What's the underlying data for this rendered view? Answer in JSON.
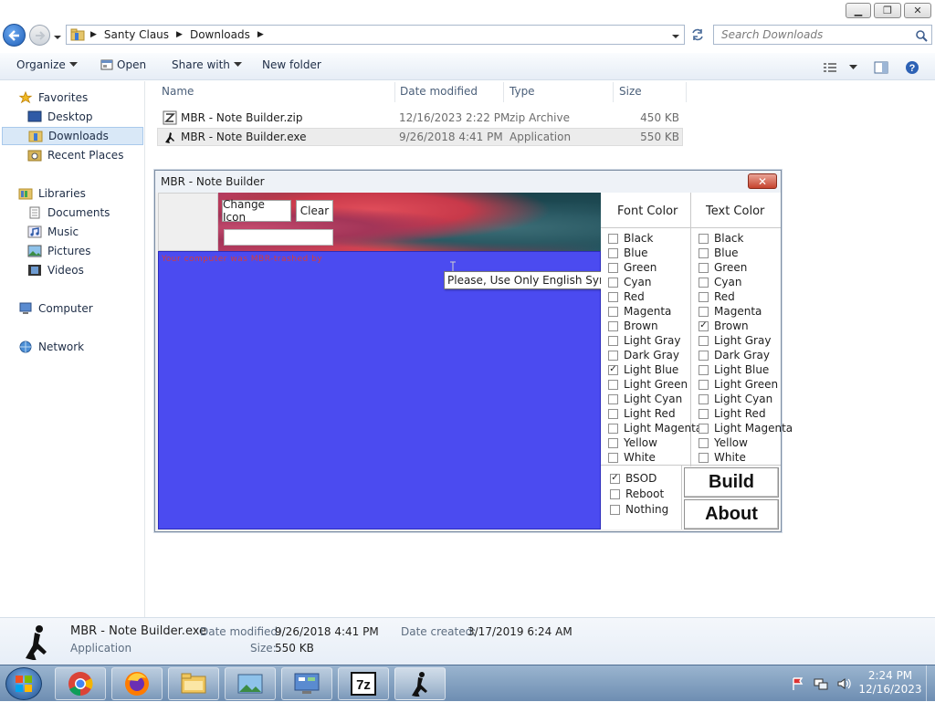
{
  "window": {
    "minimize_label": "▁",
    "restore_label": "❐",
    "close_label": "✕"
  },
  "address": {
    "breadcrumb": [
      "Santy Claus",
      "Downloads"
    ],
    "search_placeholder": "Search Downloads"
  },
  "toolbar": {
    "organize": "Organize",
    "open": "Open",
    "share_with": "Share with",
    "new_folder": "New folder"
  },
  "nav": {
    "favorites": "Favorites",
    "desktop": "Desktop",
    "downloads": "Downloads",
    "recent_places": "Recent Places",
    "libraries": "Libraries",
    "documents": "Documents",
    "music": "Music",
    "pictures": "Pictures",
    "videos": "Videos",
    "computer": "Computer",
    "network": "Network"
  },
  "columns": {
    "name": "Name",
    "date_modified": "Date modified",
    "type": "Type",
    "size": "Size"
  },
  "files": [
    {
      "name": "MBR - Note Builder.zip",
      "date": "12/16/2023 2:22 PM",
      "type": "zip Archive",
      "size": "450 KB"
    },
    {
      "name": "MBR - Note Builder.exe",
      "date": "9/26/2018 4:41 PM",
      "type": "Application",
      "size": "550 KB"
    }
  ],
  "details": {
    "name": "MBR - Note Builder.exe",
    "kind": "Application",
    "date_modified_label": "Date modified:",
    "date_modified": "9/26/2018 4:41 PM",
    "date_created_label": "Date created:",
    "date_created": "3/17/2019 6:24 AM",
    "size_label": "Size:",
    "size": "550 KB"
  },
  "dialog": {
    "title": "MBR - Note Builder",
    "close_label": "✕",
    "change_icon": "Change Icon",
    "clear": "Clear",
    "note_text": "Your computer was MBR-trashed by ",
    "tooltip": "Please, Use Only English Symbols",
    "font_color_header": "Font Color",
    "text_color_header": "Text Color",
    "colors": [
      "Black",
      "Blue",
      "Green",
      "Cyan",
      "Red",
      "Magenta",
      "Brown",
      "Light Gray",
      "Dark Gray",
      "Light Blue",
      "Light Green",
      "Light Cyan",
      "Light Red",
      "Light Magenta",
      "Yellow",
      "White"
    ],
    "font_color_checked": "Light Blue",
    "text_color_checked": "Brown",
    "options": [
      {
        "label": "BSOD",
        "checked": true
      },
      {
        "label": "Reboot",
        "checked": false
      },
      {
        "label": "Nothing",
        "checked": false
      }
    ],
    "build": "Build",
    "about": "About",
    "note_bg_color": "#4b4bf0"
  },
  "taskbar": {
    "time": "2:24 PM",
    "date": "12/16/2023"
  }
}
